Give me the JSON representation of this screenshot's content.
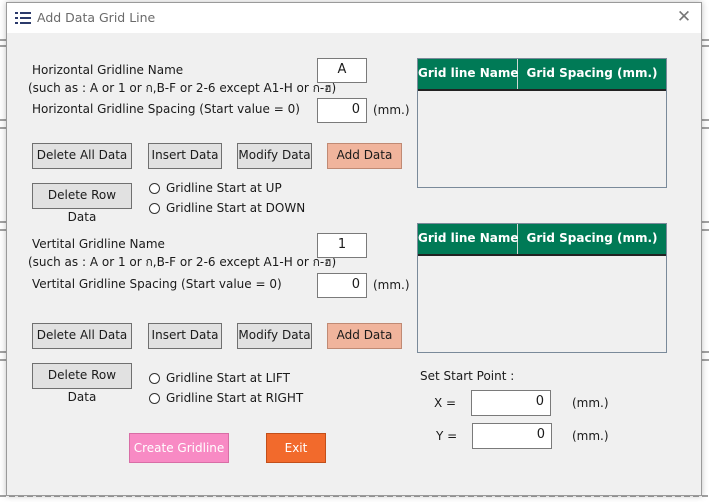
{
  "window": {
    "title": "Add Data Grid Line"
  },
  "icons": {
    "app": "list-icon",
    "close": "close-icon"
  },
  "horizontal": {
    "name_label": "Horizontal Gridline Name",
    "name_hint": "(such as : A or 1 or ก,B-F or 2-6 except A1-H or ก-ฮ)",
    "name_value": "A",
    "spacing_label": "Horizontal Gridline Spacing (Start value = 0)",
    "spacing_value": "0",
    "unit": "(mm.)",
    "buttons": {
      "delete_all": "Delete All Data",
      "insert": "Insert Data",
      "modify": "Modify Data",
      "add": "Add Data",
      "delete_row": "Delete Row Data"
    },
    "radio_up": "Gridline Start at UP",
    "radio_down": "Gridline Start at DOWN",
    "grid": {
      "col1": "Grid line Name",
      "col2": "Grid Spacing (mm.)"
    }
  },
  "vertical": {
    "name_label": "Vertital Gridline Name",
    "name_hint": "(such as : A or 1 or ก,B-F or 2-6 except A1-H or ก-ฮ)",
    "name_value": "1",
    "spacing_label": "Vertital Gridline Spacing (Start value = 0)",
    "spacing_value": "0",
    "unit": "(mm.)",
    "buttons": {
      "delete_all": "Delete All Data",
      "insert": "Insert Data",
      "modify": "Modify Data",
      "add": "Add Data",
      "delete_row": "Delete Row Data"
    },
    "radio_left": "Gridline Start at LIFT",
    "radio_right": "Gridline Start at RIGHT",
    "grid": {
      "col1": "Grid line Name",
      "col2": "Grid Spacing (mm.)"
    }
  },
  "start_point": {
    "label": "Set Start Point :",
    "x_label": "X =",
    "x_value": "0",
    "y_label": "Y =",
    "y_value": "0",
    "unit": "(mm.)"
  },
  "actions": {
    "create": "Create Gridline",
    "exit": "Exit"
  },
  "colors": {
    "grid_header": "#007a56",
    "add_button": "#f0b49c",
    "create_button": "#f88ac4",
    "exit_button": "#f26a2c"
  }
}
